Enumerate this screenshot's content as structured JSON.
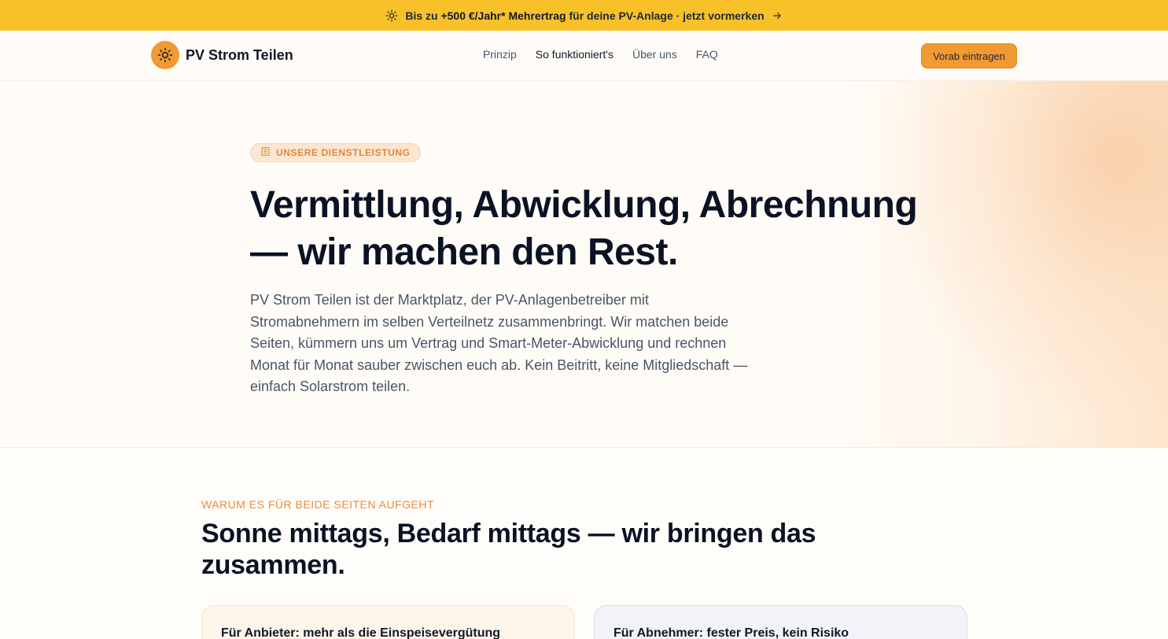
{
  "announcement": {
    "prefix": "Bis zu",
    "highlight": "+500 €/Jahr* Mehrertrag",
    "suffix": "für deine PV-Anlage · jetzt vormerken"
  },
  "header": {
    "brand": "PV Strom Teilen",
    "nav": [
      "Prinzip",
      "So funktioniert's",
      "Über uns",
      "FAQ"
    ],
    "cta_label": "Vorab eintragen"
  },
  "hero": {
    "badge": "UNSERE DIENSTLEISTUNG",
    "title_line1": "Vermittlung, Abwicklung, Abrechnung",
    "title_line2": "— wir machen den Rest.",
    "body": "PV Strom Teilen ist der Marktplatz, der PV-Anlagenbetreiber mit Stromabnehmern im selben Verteilnetz zusammenbringt. Wir matchen beide Seiten, kümmern uns um Vertrag und Smart-Meter-Abwicklung und rechnen Monat für Monat sauber zwischen euch ab. Kein Beitritt, keine Mitgliedschaft — einfach Solarstrom teilen."
  },
  "benefits": {
    "eyebrow": "WARUM ES FÜR BEIDE SEITEN AUFGEHT",
    "title": "Sonne mittags, Bedarf mittags — wir bringen das zusammen.",
    "cards": [
      {
        "title": "Für Anbieter: mehr als die Einspeisevergütung"
      },
      {
        "title": "Für Abnehmer: fester Preis, kein Risiko"
      }
    ]
  },
  "colors": {
    "announcement_bg": "#f8c12a",
    "accent": "#f19a33",
    "heading": "#0b1224"
  }
}
